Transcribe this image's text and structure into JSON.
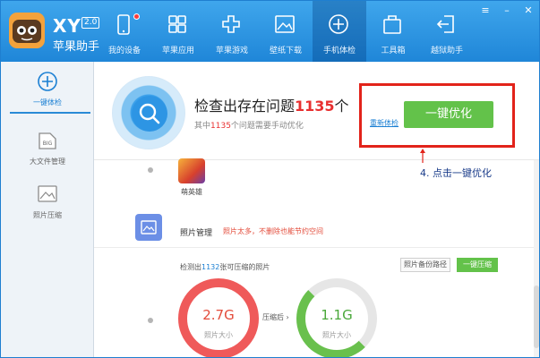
{
  "app": {
    "brand": "XY",
    "version": "2.0",
    "name": "苹果助手"
  },
  "nav": {
    "items": [
      {
        "label": "我的设备",
        "icon": "phone-icon"
      },
      {
        "label": "苹果应用",
        "icon": "apps-grid-icon"
      },
      {
        "label": "苹果游戏",
        "icon": "gamepad-icon"
      },
      {
        "label": "壁纸下载",
        "icon": "image-icon"
      },
      {
        "label": "手机体检",
        "icon": "plus-circle-icon"
      },
      {
        "label": "工具箱",
        "icon": "toolbox-icon"
      },
      {
        "label": "越狱助手",
        "icon": "exit-icon"
      }
    ]
  },
  "sidebar": {
    "items": [
      {
        "label": "一键体检",
        "icon": "plus-circle-icon"
      },
      {
        "label": "大文件管理",
        "icon": "file-icon",
        "badge": "BIG"
      },
      {
        "label": "照片压缩",
        "icon": "image-icon"
      }
    ]
  },
  "scan": {
    "title_prefix": "检查出存在问题",
    "title_count": "1135",
    "title_suffix": "个",
    "sub_prefix": "其中",
    "sub_count": "1135",
    "sub_suffix": "个问题需要手动优化",
    "rescan_label": "重新体检",
    "optimize_label": "一键优化"
  },
  "annotation": {
    "text": "4. 点击一键优化"
  },
  "app_item": {
    "name": "萌英雄"
  },
  "photo": {
    "title": "照片管理",
    "note": "照片太多，不删除也能节约空间",
    "detect_prefix": "检测出",
    "detect_count": "1132",
    "detect_suffix": "张可压缩的照片",
    "backup_label": "照片备份路径",
    "compress_label": "一键压缩",
    "before_value": "2.7G",
    "before_label": "照片大小",
    "after_connector": "压缩后",
    "after_value": "1.1G",
    "after_label": "照片大小"
  },
  "colors": {
    "accent_blue": "#1f86d8",
    "button_green": "#63c24a",
    "alert_red": "#e83030",
    "highlight_red": "#e2231a"
  }
}
